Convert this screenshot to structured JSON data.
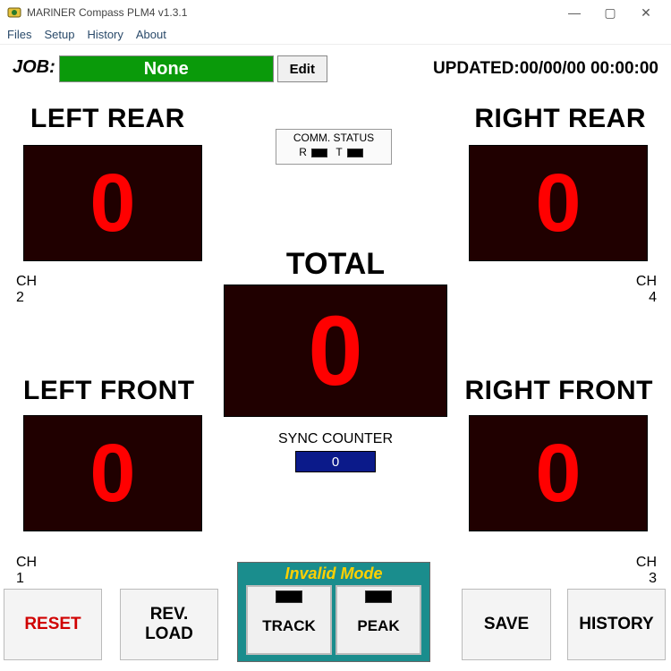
{
  "window": {
    "title": "MARlNER Compass PLM4  v1.3.1"
  },
  "menu": {
    "files": "Files",
    "setup": "Setup",
    "history": "History",
    "about": "About"
  },
  "job": {
    "label": "JOB:",
    "value": "None",
    "edit": "Edit"
  },
  "updated": {
    "label": "UPDATED:",
    "value": "00/00/00 00:00:00"
  },
  "comm": {
    "title": "COMM. STATUS",
    "r": "R",
    "t": "T"
  },
  "panels": {
    "left_rear": {
      "label": "LEFT REAR",
      "value": "0",
      "ch_label": "CH",
      "ch_num": "2"
    },
    "right_rear": {
      "label": "RIGHT REAR",
      "value": "0",
      "ch_label": "CH",
      "ch_num": "4"
    },
    "left_front": {
      "label": "LEFT FRONT",
      "value": "0",
      "ch_label": "CH",
      "ch_num": "1"
    },
    "right_front": {
      "label": "RIGHT FRONT",
      "value": "0",
      "ch_label": "CH",
      "ch_num": "3"
    },
    "total": {
      "label": "TOTAL",
      "value": "0"
    }
  },
  "sync": {
    "label": "SYNC COUNTER",
    "value": "0"
  },
  "mode": {
    "header": "Invalid Mode",
    "track": "TRACK",
    "peak": "PEAK"
  },
  "buttons": {
    "reset": "RESET",
    "revload": "REV.\nLOAD",
    "save": "SAVE",
    "history": "HISTORY"
  },
  "colors": {
    "reset": "#d00000"
  }
}
